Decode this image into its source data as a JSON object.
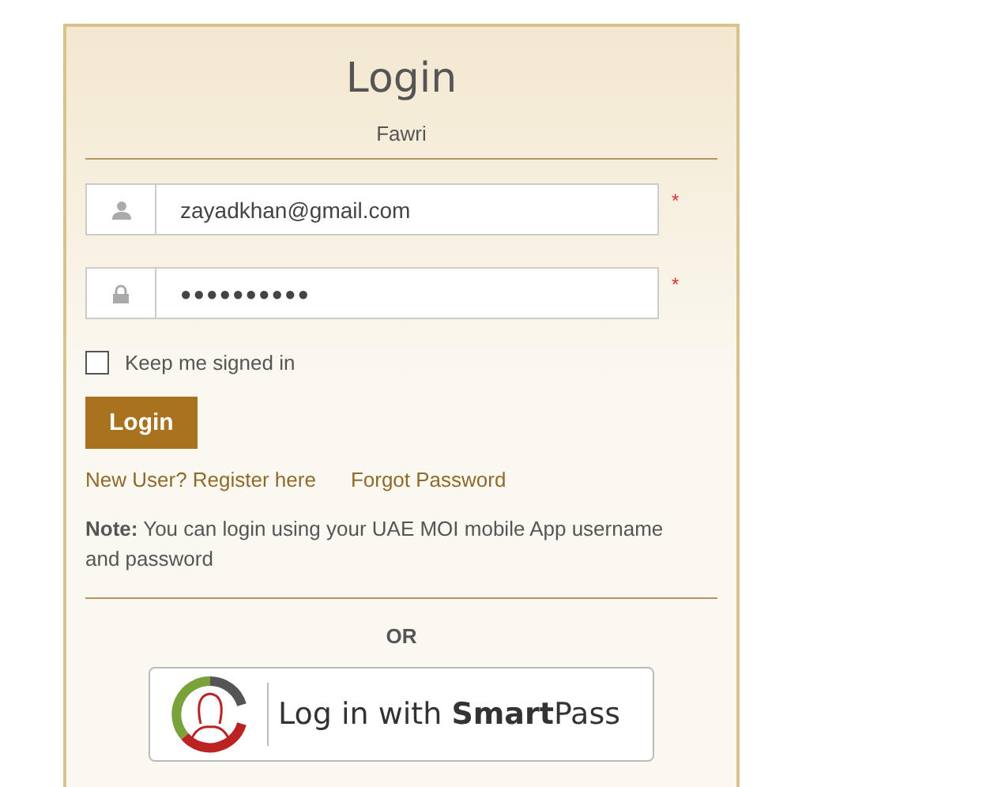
{
  "title": "Login",
  "subtitle": "Fawri",
  "fields": [
    {
      "kind": "user",
      "value": "zayadkhan@gmail.com",
      "required_mark": "*"
    },
    {
      "kind": "lock",
      "value": "●●●●●●●●●●",
      "required_mark": "*"
    }
  ],
  "keep_signed_in": {
    "label": "Keep me signed in",
    "checked": false
  },
  "login_button": "Login",
  "links": [
    "New User? Register here",
    "Forgot Password"
  ],
  "note": "**Note:** You can login using your UAE MOI mobile App username and password",
  "divider_text": "OR",
  "smartpass_button": "Log in with **Smart**Pass"
}
